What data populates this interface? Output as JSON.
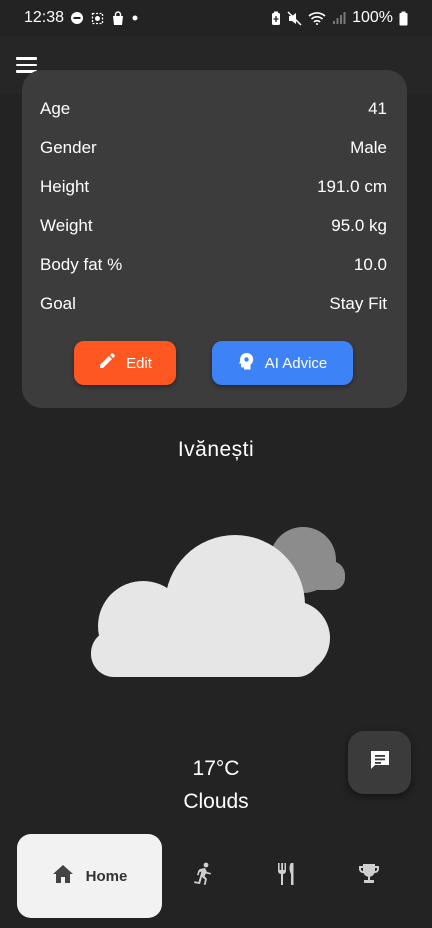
{
  "status_bar": {
    "time": "12:38",
    "battery_percent": "100%",
    "icons_left": [
      "dnd-icon",
      "brightness-icon",
      "shopping-bag-icon",
      "dot-icon"
    ],
    "icons_right": [
      "battery-saver-icon",
      "mute-icon",
      "wifi-icon",
      "signal-icon",
      "battery-icon"
    ]
  },
  "appbar": {
    "menu_icon": "hamburger-menu-icon"
  },
  "profile": {
    "rows": [
      {
        "label": "Age",
        "value": "41"
      },
      {
        "label": "Gender",
        "value": "Male"
      },
      {
        "label": "Height",
        "value": "191.0 cm"
      },
      {
        "label": "Weight",
        "value": "95.0 kg"
      },
      {
        "label": "Body fat %",
        "value": "10.0"
      },
      {
        "label": "Goal",
        "value": "Stay Fit"
      }
    ],
    "edit_label": "Edit",
    "ai_label": "AI Advice",
    "colors": {
      "edit": "#ff5722",
      "ai": "#3d82f6",
      "card": "#3c3c3c"
    }
  },
  "weather": {
    "city": "Ivănești",
    "temperature": "17°C",
    "condition": "Clouds",
    "icon": "clouds-icon"
  },
  "fab": {
    "icon": "chat-icon"
  },
  "bottom_nav": {
    "items": [
      {
        "label": "Home",
        "icon": "home-icon",
        "selected": true
      },
      {
        "icon": "running-icon"
      },
      {
        "icon": "restaurant-icon"
      },
      {
        "icon": "trophy-icon"
      }
    ]
  }
}
